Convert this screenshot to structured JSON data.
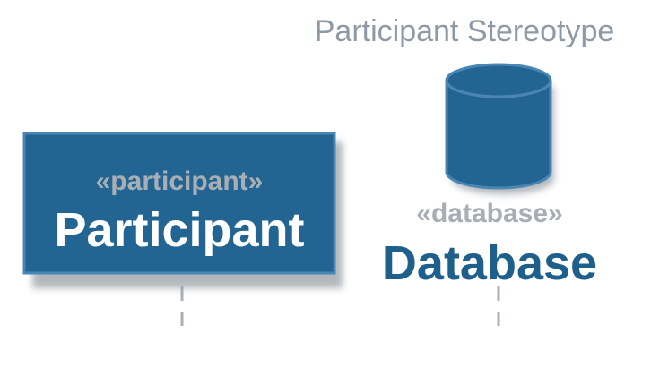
{
  "diagram": {
    "title": "Participant Stereotype",
    "participant": {
      "stereotype": "«participant»",
      "name": "Participant",
      "shape": "rectangle"
    },
    "database": {
      "stereotype": "«database»",
      "name": "Database",
      "shape": "cylinder"
    }
  },
  "colors": {
    "title": "#8e99a8",
    "box_fill": "#236592",
    "box_stroke": "#4a86b4",
    "stereotype_text": "#a8aeb5",
    "participant_name": "#ffffff",
    "database_name": "#1f5f8b",
    "lifeline": "#a9b0b7",
    "shadow": "#9aa0a6"
  }
}
